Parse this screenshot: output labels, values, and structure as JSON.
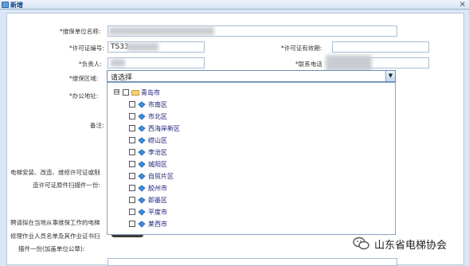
{
  "window": {
    "title": "新增",
    "close_glyph": "×"
  },
  "form": {
    "unit_name_label": "*维保单位名称:",
    "license_no_label": "*许可证编号:",
    "license_no_value": "TS33",
    "license_valid_label": "*许可证有效期:",
    "manager_label": "*负责人:",
    "phone_label": "*联系电话",
    "region_label": "*维保区域:",
    "region_value": "请选择",
    "address_label": "*办公地址:",
    "remark_label": "备注:",
    "scan_label_line1": "电梯安装、改造、维修许可证或制",
    "scan_label_line2": "造许可证原件扫描件一份:",
    "staff_label_line1": "聘请拟在当地从事维保工作的电梯",
    "staff_label_line2": "修理作业人员名单及其作业证书扫",
    "staff_label_line3": "描件一份(加盖单位公章):"
  },
  "tree": {
    "root": {
      "toggle": "⊟",
      "label": "青岛市"
    },
    "children": [
      {
        "label": "市南区"
      },
      {
        "label": "市北区"
      },
      {
        "label": "西海岸新区"
      },
      {
        "label": "崂山区"
      },
      {
        "label": "李沧区"
      },
      {
        "label": "城阳区"
      },
      {
        "label": "自贸片区"
      },
      {
        "label": "胶州市"
      },
      {
        "label": "即墨区"
      },
      {
        "label": "平度市"
      },
      {
        "label": "莱西市"
      }
    ]
  },
  "watermark": {
    "text": "山东省电梯协会"
  },
  "colors": {
    "title_blue": "#15428b",
    "link_text": "#1a1a7a",
    "border": "#a8bcd4"
  }
}
